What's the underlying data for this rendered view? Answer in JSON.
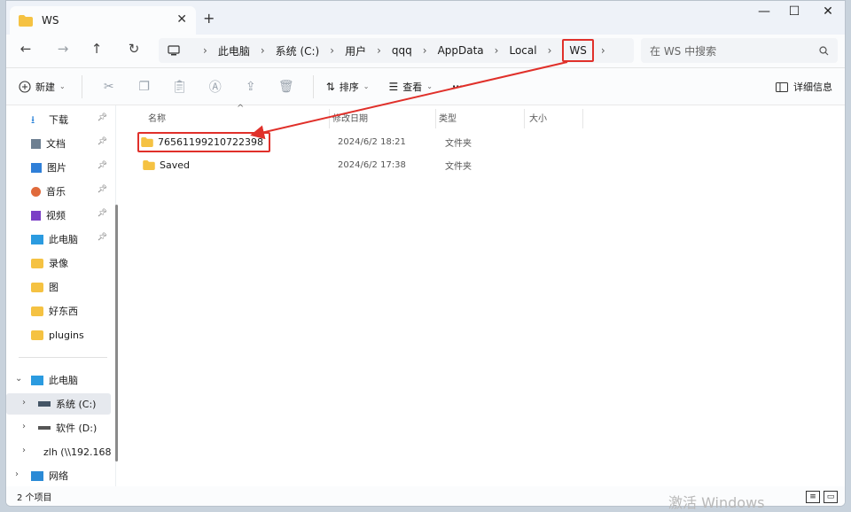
{
  "tab": {
    "title": "WS",
    "close": "✕",
    "new": "+"
  },
  "window_controls": {
    "minimize": "—",
    "maximize": "☐",
    "close": "✕"
  },
  "nav": {
    "back": "←",
    "forward": "→",
    "up": "↑",
    "refresh": "↻"
  },
  "breadcrumb": [
    "此电脑",
    "系统 (C:)",
    "用户",
    "qqq",
    "AppData",
    "Local",
    "WS"
  ],
  "search": {
    "placeholder": "在 WS 中搜索"
  },
  "toolbar": {
    "new_label": "新建",
    "sort_label": "排序",
    "view_label": "查看",
    "more": "···",
    "details_label": "详细信息"
  },
  "sidebar": {
    "quick": [
      {
        "label": "下载",
        "icon": "download-icon",
        "pinned": true
      },
      {
        "label": "文档",
        "icon": "document-icon",
        "pinned": true
      },
      {
        "label": "图片",
        "icon": "pictures-icon",
        "pinned": true
      },
      {
        "label": "音乐",
        "icon": "music-icon",
        "pinned": true
      },
      {
        "label": "视频",
        "icon": "video-icon",
        "pinned": true
      },
      {
        "label": "此电脑",
        "icon": "computer-icon",
        "pinned": true
      },
      {
        "label": "录像",
        "icon": "folder-icon",
        "pinned": false
      },
      {
        "label": "图",
        "icon": "folder-icon",
        "pinned": false
      },
      {
        "label": "好东西",
        "icon": "folder-icon",
        "pinned": false
      },
      {
        "label": "plugins",
        "icon": "folder-icon",
        "pinned": false
      }
    ],
    "tree": [
      {
        "label": "此电脑",
        "caret": "⌄"
      },
      {
        "label": "系统 (C:)",
        "caret": "›"
      },
      {
        "label": "软件 (D:)",
        "caret": "›"
      },
      {
        "label": "zlh (\\\\192.168",
        "caret": "›"
      },
      {
        "label": "网络",
        "caret": "›"
      }
    ]
  },
  "columns": {
    "name": "名称",
    "modified": "修改日期",
    "type": "类型",
    "size": "大小"
  },
  "files": [
    {
      "name": "76561199210722398",
      "modified": "2024/6/2 18:21",
      "type": "文件夹",
      "size": ""
    },
    {
      "name": "Saved",
      "modified": "2024/6/2 17:38",
      "type": "文件夹",
      "size": ""
    }
  ],
  "status": {
    "count": "2 个项目"
  },
  "watermark": "激活 Windows",
  "colors": {
    "highlight": "#e0302a",
    "folder": "#f5c242",
    "accent": "#0a64c8"
  }
}
